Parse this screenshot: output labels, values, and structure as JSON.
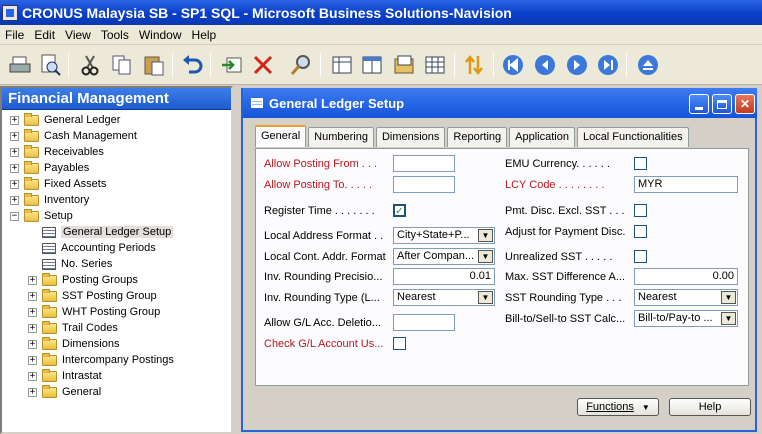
{
  "window": {
    "title": "CRONUS Malaysia SB - SP1 SQL - Microsoft Business Solutions-Navision"
  },
  "menu": [
    "File",
    "Edit",
    "View",
    "Tools",
    "Window",
    "Help"
  ],
  "toolbar_icons": [
    "print-icon",
    "print-preview-icon",
    "cut-icon",
    "copy-icon",
    "paste-icon",
    "undo-icon",
    "insert-icon",
    "delete-icon",
    "find-icon",
    "list-view-icon",
    "card-view-icon",
    "form-icon",
    "table-icon",
    "sort-icon",
    "first-record-icon",
    "previous-record-icon",
    "next-record-icon",
    "last-record-icon",
    "eject-icon"
  ],
  "navigation": {
    "title": "Financial Management",
    "items": [
      {
        "label": "General Ledger",
        "sign": "+"
      },
      {
        "label": "Cash Management",
        "sign": "+"
      },
      {
        "label": "Receivables",
        "sign": "+"
      },
      {
        "label": "Payables",
        "sign": "+"
      },
      {
        "label": "Fixed Assets",
        "sign": "+"
      },
      {
        "label": "Inventory",
        "sign": "+"
      },
      {
        "label": "Setup",
        "sign": "−"
      },
      {
        "label": "General Ledger Setup"
      },
      {
        "label": "Accounting Periods"
      },
      {
        "label": "No. Series"
      },
      {
        "label": "Posting Groups",
        "sign": "+"
      },
      {
        "label": "SST Posting Group",
        "sign": "+"
      },
      {
        "label": "WHT Posting Group",
        "sign": "+"
      },
      {
        "label": "Trail Codes",
        "sign": "+"
      },
      {
        "label": "Dimensions",
        "sign": "+"
      },
      {
        "label": "Intercompany Postings",
        "sign": "+"
      },
      {
        "label": "Intrastat",
        "sign": "+"
      },
      {
        "label": "General",
        "sign": "+"
      }
    ]
  },
  "form": {
    "title": "General Ledger Setup",
    "tabs": [
      "General",
      "Numbering",
      "Dimensions",
      "Reporting",
      "Application",
      "Local Functionalities"
    ],
    "left": {
      "allow_posting_from": {
        "label": "Allow Posting From  . . .",
        "value": ""
      },
      "allow_posting_to": {
        "label": "Allow Posting To. . . . .",
        "value": ""
      },
      "register_time": {
        "label": "Register Time . . . . . . .",
        "checked": true
      },
      "local_address_format": {
        "label": "Local Address Format  . .",
        "value": "City+State+P..."
      },
      "local_cont_addr_format": {
        "label": "Local Cont. Addr. Format",
        "value": "After Compan..."
      },
      "inv_rounding_precision": {
        "label": "Inv. Rounding Precisio...",
        "value": "0.01"
      },
      "inv_rounding_type": {
        "label": "Inv. Rounding Type (L...",
        "value": "Nearest"
      },
      "allow_gl_acc_deletion": {
        "label": "Allow G/L Acc. Deletio...",
        "value": ""
      },
      "check_gl_account_usage": {
        "label": "Check G/L Account Us...",
        "checked": false
      }
    },
    "right": {
      "emu_currency": {
        "label": "EMU Currency. . . . . .",
        "checked": false
      },
      "lcy_code": {
        "label": "LCY Code . . . . . . . .",
        "value": "MYR"
      },
      "pmt_disc_excl_sst": {
        "label": "Pmt. Disc. Excl. SST . . .",
        "checked": false
      },
      "adjust_for_payment_disc": {
        "label": "Adjust for Payment Disc.",
        "checked": false
      },
      "unrealized_sst": {
        "label": "Unrealized SST  . . . . .",
        "checked": false
      },
      "max_sst_difference": {
        "label": "Max. SST Difference A...",
        "value": "0.00"
      },
      "sst_rounding_type": {
        "label": "SST Rounding Type  . . .",
        "value": "Nearest"
      },
      "bill_to_sell_to": {
        "label": "Bill-to/Sell-to SST Calc...",
        "value": "Bill-to/Pay-to ..."
      }
    },
    "buttons": {
      "functions": "Functions",
      "help": "Help"
    }
  }
}
